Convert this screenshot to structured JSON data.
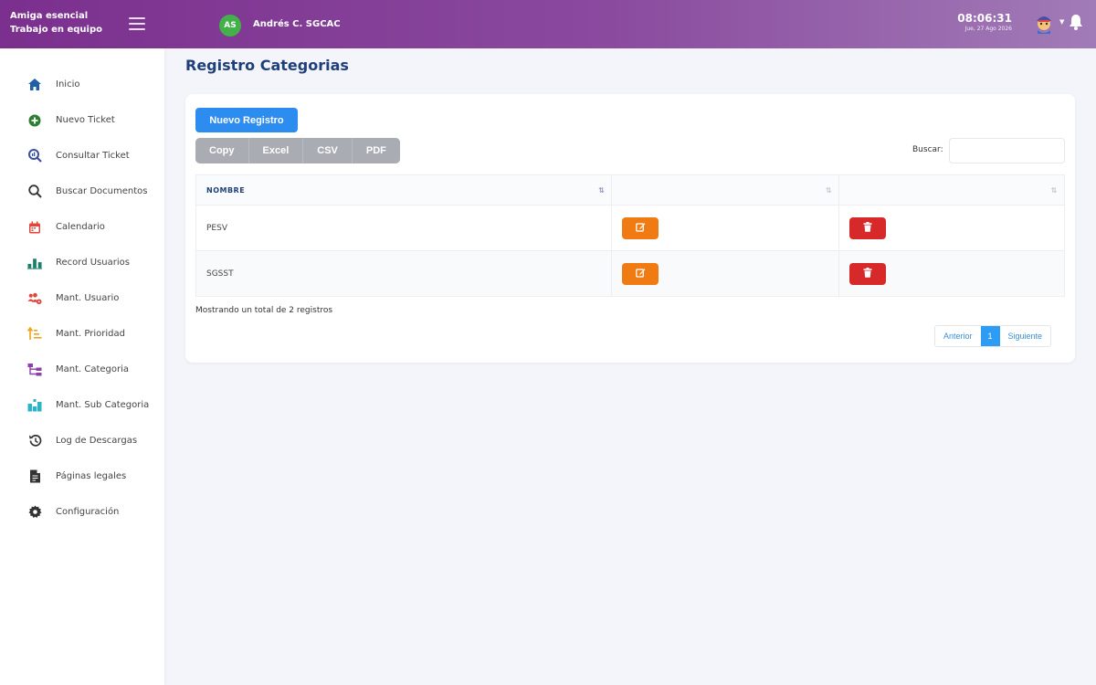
{
  "header": {
    "brand_line1": "Amiga esencial",
    "brand_line2": "Trabajo en equipo",
    "avatar_initials": "AS",
    "user_name": "Andrés C. SGCAC",
    "time": "08:06:31",
    "date": "Jue, 27 Ago 2026",
    "icons": {
      "menu": "hamburger-icon",
      "profile": "profile-avatar-icon",
      "notifications": "bell-icon"
    }
  },
  "sidebar": {
    "items": [
      {
        "label": "Inicio",
        "icon": "home-icon",
        "color": "#1f5fa8"
      },
      {
        "label": "Nuevo Ticket",
        "icon": "plus-circle-icon",
        "color": "#2e7d32"
      },
      {
        "label": "Consultar Ticket",
        "icon": "search-chart-icon",
        "color": "#3a4fa0"
      },
      {
        "label": "Buscar Documentos",
        "icon": "search-icon",
        "color": "#333333"
      },
      {
        "label": "Calendario",
        "icon": "calendar-icon",
        "color": "#e0463a"
      },
      {
        "label": "Record Usuarios",
        "icon": "bar-chart-icon",
        "color": "#1b7f6b"
      },
      {
        "label": "Mant. Usuario",
        "icon": "users-gear-icon",
        "color": "#e0463a"
      },
      {
        "label": "Mant. Prioridad",
        "icon": "sort-priority-icon",
        "color": "#f0a21a"
      },
      {
        "label": "Mant. Categoria",
        "icon": "category-tree-icon",
        "color": "#8e3fa8"
      },
      {
        "label": "Mant. Sub Categoria",
        "icon": "subcategory-icon",
        "color": "#2bb3c9"
      },
      {
        "label": "Log de Descargas",
        "icon": "history-icon",
        "color": "#333333"
      },
      {
        "label": "Páginas legales",
        "icon": "legal-file-icon",
        "color": "#333333"
      },
      {
        "label": "Configuración",
        "icon": "gear-icon",
        "color": "#333333"
      }
    ]
  },
  "main": {
    "title": "Registro Categorias",
    "new_button": "Nuevo Registro",
    "export_buttons": [
      "Copy",
      "Excel",
      "CSV",
      "PDF"
    ],
    "search_label": "Buscar:",
    "search_value": "",
    "table": {
      "columns": [
        "NOMBRE",
        "",
        ""
      ],
      "rows": [
        {
          "nombre": "PESV"
        },
        {
          "nombre": "SGSST"
        }
      ],
      "row_actions": {
        "edit": "edit-icon",
        "delete": "trash-icon"
      }
    },
    "info_text": "Mostrando un total de 2 registros",
    "pagination": {
      "prev": "Anterior",
      "current": "1",
      "next": "Siguiente"
    }
  },
  "colors": {
    "header_start": "#7b2f8e",
    "accent_blue": "#2d8cf0",
    "edit_orange": "#f07b12",
    "delete_red": "#d8292a",
    "title_blue": "#1f3f7a"
  }
}
